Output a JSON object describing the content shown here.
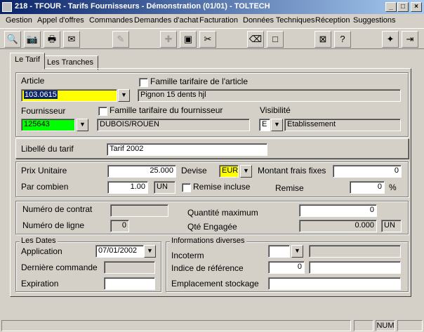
{
  "window": {
    "title": "218 - TFOUR - Tarifs Fournisseurs - Démonstration (01/01) - TOLTECH"
  },
  "menu": [
    {
      "label": "Gestion"
    },
    {
      "label": "Appel d'offres"
    },
    {
      "label": "Commandes"
    },
    {
      "label": "Demandes d'achat"
    },
    {
      "label": "Facturation"
    },
    {
      "label": "Données Techniques"
    },
    {
      "label": "Réception"
    },
    {
      "label": "Suggestions"
    }
  ],
  "toolbar": {
    "icons": [
      "search-icon",
      "camera-icon",
      "print-icon",
      "mail-icon",
      "disabled-edit-icon",
      "add-icon",
      "save-icon",
      "cut-icon",
      "eraser-icon",
      "new-page-icon",
      "ticket-icon",
      "help-icon",
      "wand-icon",
      "exit-icon"
    ]
  },
  "tabs": [
    {
      "label": "Le Tarif"
    },
    {
      "label": "Les Tranches"
    }
  ],
  "article": {
    "label": "Article",
    "code": "103.0615",
    "famille_label": "Famille tarifaire de l'article",
    "description": "Pignon 15 dents hjl"
  },
  "fournisseur": {
    "label": "Fournisseur",
    "code": "125643",
    "famille_label": "Famille tarifaire du fournisseur",
    "name": "DUBOIS/ROUEN"
  },
  "visibilite": {
    "label": "Visibilité",
    "code": "E",
    "value": "Etablissement"
  },
  "libelle": {
    "label": "Libellé du tarif",
    "value": "Tarif 2002"
  },
  "prix": {
    "prix_unitaire_label": "Prix Unitaire",
    "prix_unitaire": "25.000",
    "devise_label": "Devise",
    "devise": "EUR",
    "montant_frais_label": "Montant frais fixes",
    "montant_frais": "0",
    "par_combien_label": "Par combien",
    "par_combien": "1.00",
    "unite": "UN",
    "remise_incluse_label": "Remise incluse",
    "remise_label": "Remise",
    "remise": "0",
    "remise_unit": "%"
  },
  "contrat": {
    "numero_contrat_label": "Numéro de contrat",
    "numero_contrat": "",
    "numero_ligne_label": "Numéro de ligne",
    "numero_ligne": "0",
    "quantite_max_label": "Quantité maximum",
    "quantite_max": "0",
    "qte_engagee_label": "Qté Engagée",
    "qte_engagee": "0.000",
    "qte_unite": "UN"
  },
  "dates": {
    "title": "Les Dates",
    "application_label": "Application",
    "application": "07/01/2002",
    "derniere_commande_label": "Dernière commande",
    "derniere_commande": "",
    "expiration_label": "Expiration",
    "expiration": ""
  },
  "infos": {
    "title": "Informations diverses",
    "incoterm_label": "Incoterm",
    "incoterm_code": "",
    "incoterm_desc": "",
    "indice_label": "Indice de référence",
    "indice_value": "0",
    "indice_desc": "",
    "emplacement_label": "Emplacement stockage",
    "emplacement": ""
  },
  "status": {
    "num": "NUM"
  }
}
